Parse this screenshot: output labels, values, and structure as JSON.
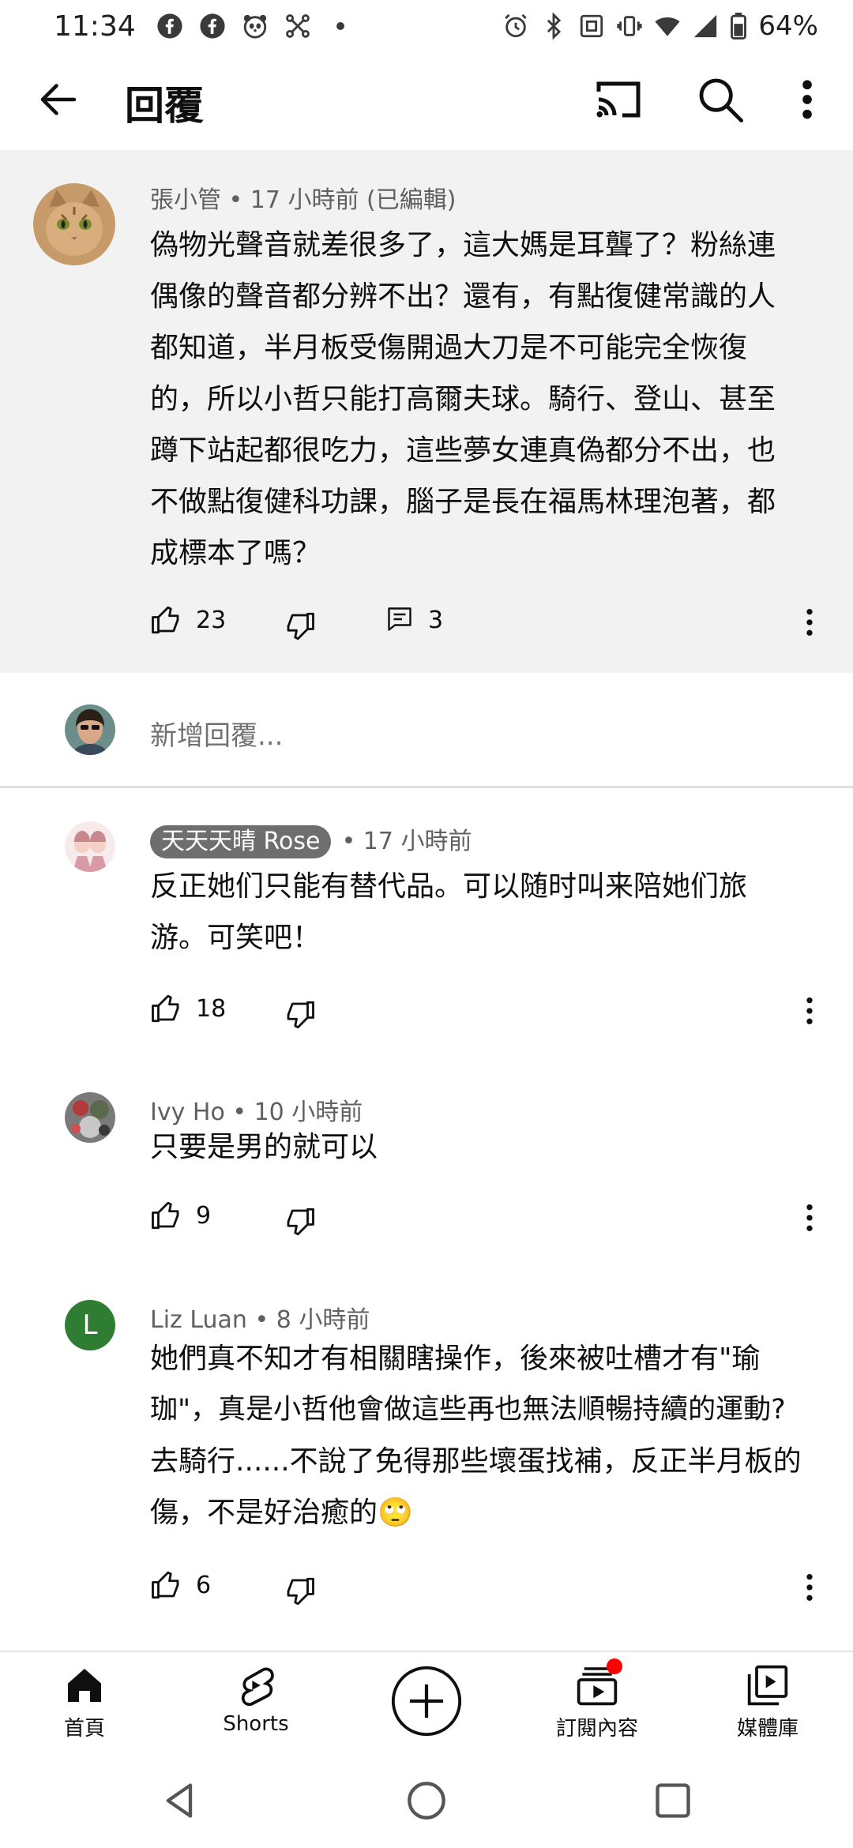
{
  "status_bar": {
    "time": "11:34",
    "battery": "64%"
  },
  "app_bar": {
    "title": "回覆"
  },
  "parent_comment": {
    "author": "張小管",
    "meta": "張小管 • 17 小時前 (已編輯)",
    "lines": [
      "偽物光聲音就差很多了，這大媽是耳聾了？粉絲連",
      "偶像的聲音都分辨不出？還有，有點復健常識的人",
      "都知道，半月板受傷開過大刀是不可能完全恢復",
      "的，所以小哲只能打高爾夫球。騎行、登山、甚至",
      "蹲下站起都很吃力，這些夢女連真偽都分不出，也",
      "不做點復健科功課，腦子是長在福馬林理泡著，都",
      "成標本了嗎？"
    ],
    "likes": "23",
    "replies": "3"
  },
  "reply_input": {
    "placeholder": "新增回覆..."
  },
  "replies": [
    {
      "author": "天天天晴 Rose",
      "time": "• 17 小時前",
      "lines": [
        "反正她们只能有替代品。可以随时叫来陪她们旅",
        "游。可笑吧！"
      ],
      "likes": "18"
    },
    {
      "author": "Ivy Ho",
      "meta": "Ivy Ho • 10 小時前",
      "lines": [
        "只要是男的就可以"
      ],
      "likes": "9"
    },
    {
      "author": "Liz Luan",
      "avatar_letter": "L",
      "meta": "Liz Luan • 8 小時前",
      "lines": [
        "她們真不知才有相關瞎操作，後來被吐槽才有\"瑜",
        "珈\"，真是小哲他會做這些再也無法順暢持續的運動?",
        "去騎行......不說了免得那些壞蛋找補，反正半月板的",
        "傷，不是好治癒的🙄"
      ],
      "likes": "6"
    }
  ],
  "bottom_nav": {
    "home": "首頁",
    "shorts": "Shorts",
    "subscriptions": "訂閱內容",
    "library": "媒體庫"
  },
  "colors": {
    "parent_bg": "#f2f2f2",
    "liz_avatar": "#2e7d32",
    "notification_dot": "#ff0000"
  }
}
